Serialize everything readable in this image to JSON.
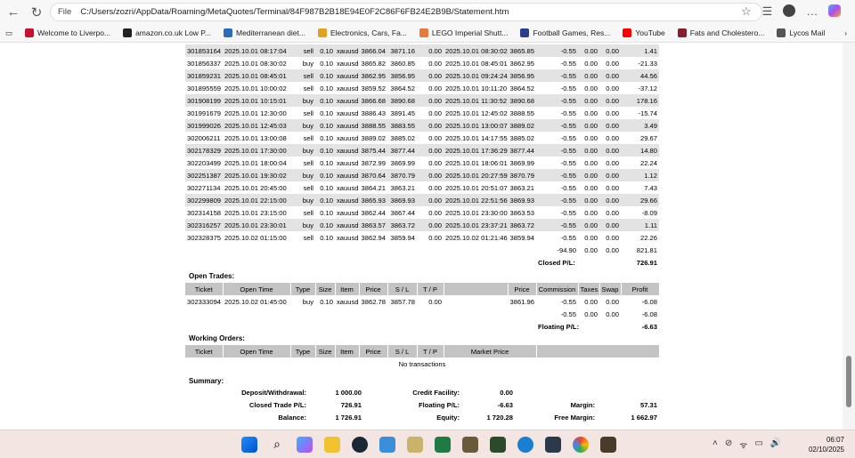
{
  "browser": {
    "file_label": "File",
    "url": "C:/Users/zozri/AppData/Roaming/MetaQuotes/Terminal/84F987B2B18E94E0F2C86F6FB24E2B9B/Statement.htm",
    "bookmarks": [
      {
        "label": "Welcome to Liverpo...",
        "color": "#c8102e"
      },
      {
        "label": "amazon.co.uk Low P...",
        "color": "#222"
      },
      {
        "label": "Mediterranean diet...",
        "color": "#2a6ebb"
      },
      {
        "label": "Electronics, Cars, Fa...",
        "color": "#e0a020"
      },
      {
        "label": "LEGO Imperial Shutt...",
        "color": "#e8793a"
      },
      {
        "label": "Football Games, Res...",
        "color": "#2b3d8f"
      },
      {
        "label": "YouTube",
        "color": "#ff0000"
      },
      {
        "label": "Fats and Cholestero...",
        "color": "#8a1c2b"
      },
      {
        "label": "Lycos Mail",
        "color": "#555"
      }
    ]
  },
  "closed": {
    "rows": [
      [
        "301853164",
        "2025.10.01 08:17:04",
        "sell",
        "0.10",
        "xauusd",
        "3866.04",
        "3871.16",
        "0.00",
        "2025.10.01 08:30:02",
        "3865.85",
        "-0.55",
        "0.00",
        "0.00",
        "1.41"
      ],
      [
        "301856337",
        "2025.10.01 08:30:02",
        "buy",
        "0.10",
        "xauusd",
        "3865.82",
        "3860.85",
        "0.00",
        "2025.10.01 08:45:01",
        "3862.95",
        "-0.55",
        "0.00",
        "0.00",
        "-21.33"
      ],
      [
        "301859231",
        "2025.10.01 08:45:01",
        "sell",
        "0.10",
        "xauusd",
        "3862.95",
        "3856.95",
        "0.00",
        "2025.10.01 09:24:24",
        "3856.95",
        "-0.55",
        "0.00",
        "0.00",
        "44.56"
      ],
      [
        "301895559",
        "2025.10.01 10:00:02",
        "sell",
        "0.10",
        "xauusd",
        "3859.52",
        "3864.52",
        "0.00",
        "2025.10.01 10:11:20",
        "3864.52",
        "-0.55",
        "0.00",
        "0.00",
        "-37.12"
      ],
      [
        "301908199",
        "2025.10.01 10:15:01",
        "buy",
        "0.10",
        "xauusd",
        "3866.68",
        "3890.68",
        "0.00",
        "2025.10.01 11:30:52",
        "3890.68",
        "-0.55",
        "0.00",
        "0.00",
        "178.16"
      ],
      [
        "301991679",
        "2025.10.01 12:30:00",
        "sell",
        "0.10",
        "xauusd",
        "3886.43",
        "3891.45",
        "0.00",
        "2025.10.01 12:45:02",
        "3888.55",
        "-0.55",
        "0.00",
        "0.00",
        "-15.74"
      ],
      [
        "301999026",
        "2025.10.01 12:45:03",
        "buy",
        "0.10",
        "xauusd",
        "3888.55",
        "3883.55",
        "0.00",
        "2025.10.01 13:00:07",
        "3889.02",
        "-0.55",
        "0.00",
        "0.00",
        "3.49"
      ],
      [
        "302006211",
        "2025.10.01 13:00:08",
        "sell",
        "0.10",
        "xauusd",
        "3889.02",
        "3885.02",
        "0.00",
        "2025.10.01 14:17:55",
        "3885.02",
        "-0.55",
        "0.00",
        "0.00",
        "29.67"
      ],
      [
        "302178329",
        "2025.10.01 17:30:00",
        "buy",
        "0.10",
        "xauusd",
        "3875.44",
        "3877.44",
        "0.00",
        "2025.10.01 17:36:29",
        "3877.44",
        "-0.55",
        "0.00",
        "0.00",
        "14.80"
      ],
      [
        "302203499",
        "2025.10.01 18:00:04",
        "sell",
        "0.10",
        "xauusd",
        "3872.99",
        "3869.99",
        "0.00",
        "2025.10.01 18:06:01",
        "3869.99",
        "-0.55",
        "0.00",
        "0.00",
        "22.24"
      ],
      [
        "302251387",
        "2025.10.01 19:30:02",
        "buy",
        "0.10",
        "xauusd",
        "3870.64",
        "3870.79",
        "0.00",
        "2025.10.01 20:27:59",
        "3870.79",
        "-0.55",
        "0.00",
        "0.00",
        "1.12"
      ],
      [
        "302271134",
        "2025.10.01 20:45:00",
        "sell",
        "0.10",
        "xauusd",
        "3864.21",
        "3863.21",
        "0.00",
        "2025.10.01 20:51:07",
        "3863.21",
        "-0.55",
        "0.00",
        "0.00",
        "7.43"
      ],
      [
        "302299809",
        "2025.10.01 22:15:00",
        "buy",
        "0.10",
        "xauusd",
        "3865.93",
        "3869.93",
        "0.00",
        "2025.10.01 22:51:56",
        "3869.93",
        "-0.55",
        "0.00",
        "0.00",
        "29.66"
      ],
      [
        "302314158",
        "2025.10.01 23:15:00",
        "sell",
        "0.10",
        "xauusd",
        "3862.44",
        "3867.44",
        "0.00",
        "2025.10.01 23:30:00",
        "3863.53",
        "-0.55",
        "0.00",
        "0.00",
        "-8.09"
      ],
      [
        "302316257",
        "2025.10.01 23:30:01",
        "buy",
        "0.10",
        "xauusd",
        "3863.57",
        "3863.72",
        "0.00",
        "2025.10.01 23:37:21",
        "3863.72",
        "-0.55",
        "0.00",
        "0.00",
        "1.11"
      ],
      [
        "302328375",
        "2025.10.02 01:15:00",
        "sell",
        "0.10",
        "xauusd",
        "3862.94",
        "3859.94",
        "0.00",
        "2025.10.02 01:21:46",
        "3859.94",
        "-0.55",
        "0.00",
        "0.00",
        "22.26"
      ]
    ],
    "totals": {
      "commission": "-94.90",
      "taxes": "0.00",
      "swap": "0.00",
      "profit": "821.81"
    },
    "pl_label": "Closed P/L:",
    "pl_value": "726.91"
  },
  "open": {
    "title": "Open Trades:",
    "headers": [
      "Ticket",
      "Open Time",
      "Type",
      "Size",
      "Item",
      "Price",
      "S / L",
      "T / P",
      "",
      "Price",
      "Commission",
      "Taxes",
      "Swap",
      "Profit"
    ],
    "row": [
      "302333094",
      "2025.10.02 01:45:00",
      "buy",
      "0.10",
      "xauusd",
      "3862.78",
      "3857.78",
      "0.00",
      "",
      "3861.96",
      "-0.55",
      "0.00",
      "0.00",
      "-6.08"
    ],
    "totals": {
      "commission": "-0.55",
      "taxes": "0.00",
      "swap": "0.00",
      "profit": "-6.08"
    },
    "pl_label": "Floating P/L:",
    "pl_value": "-6.63"
  },
  "working": {
    "title": "Working Orders:",
    "headers": [
      "Ticket",
      "Open Time",
      "Type",
      "Size",
      "Item",
      "Price",
      "S / L",
      "T / P",
      "Market Price"
    ],
    "empty": "No transactions"
  },
  "summary": {
    "title": "Summary:",
    "items": [
      [
        "Deposit/Withdrawal:",
        "1 000.00",
        "Credit Facility:",
        "0.00",
        "",
        ""
      ],
      [
        "Closed Trade P/L:",
        "726.91",
        "Floating P/L:",
        "-6.63",
        "Margin:",
        "57.31"
      ],
      [
        "Balance:",
        "1 726.91",
        "Equity:",
        "1 720.28",
        "Free Margin:",
        "1 662.97"
      ]
    ]
  },
  "taskbar": {
    "time": "06:07",
    "date": "02/10/2025"
  }
}
